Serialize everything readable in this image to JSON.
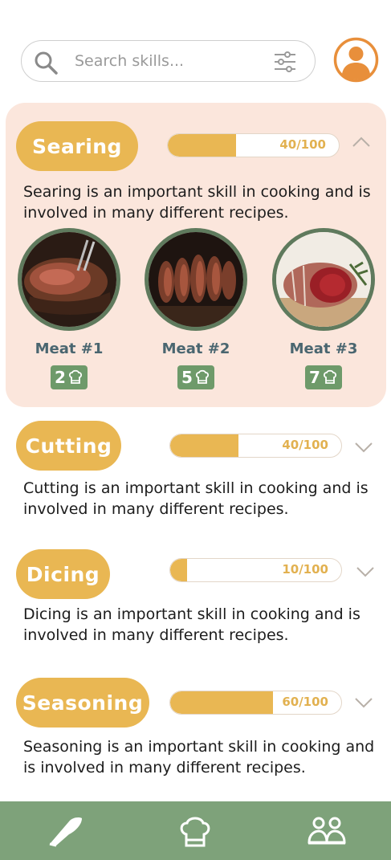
{
  "search": {
    "placeholder": "Search skills..."
  },
  "icons": {
    "search": "search-icon",
    "filter": "filter-sliders-icon",
    "profile": "user-avatar-icon",
    "chef_hat": "chef-hat-icon",
    "knife": "knife-icon",
    "people": "people-icon"
  },
  "colors": {
    "accent": "#e9b753",
    "expanded_card": "#fbe6dc",
    "green": "#7ea27a",
    "avatar": "#e88f3b"
  },
  "skills": [
    {
      "name": "Searing",
      "progress_label": "40/100",
      "progress": 0.4,
      "expanded": true,
      "description": "Searing is an important skill in cooking and is involved in many different recipes.",
      "items": [
        {
          "name": "Meat #1",
          "count": "2"
        },
        {
          "name": "Meat #2",
          "count": "5"
        },
        {
          "name": "Meat #3",
          "count": "7"
        }
      ]
    },
    {
      "name": "Cutting",
      "progress_label": "40/100",
      "progress": 0.4,
      "expanded": false,
      "description": "Cutting is an important skill in cooking and is involved in many different recipes."
    },
    {
      "name": "Dicing",
      "progress_label": "10/100",
      "progress": 0.1,
      "expanded": false,
      "description": "Dicing is an important skill in cooking and is involved in many different recipes."
    },
    {
      "name": "Seasoning",
      "progress_label": "60/100",
      "progress": 0.6,
      "expanded": false,
      "description": "Seasoning is an important skill in cooking and is involved in many different recipes."
    }
  ]
}
